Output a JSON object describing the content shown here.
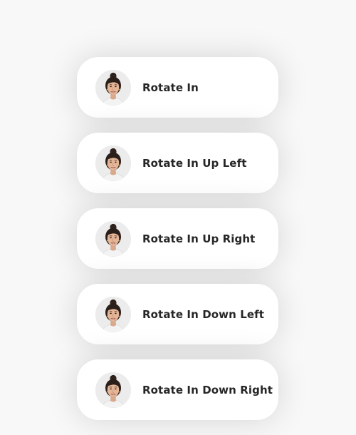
{
  "items": [
    {
      "label": "Rotate In",
      "icon": "woman-avatar-icon"
    },
    {
      "label": "Rotate In Up Left",
      "icon": "woman-avatar-icon"
    },
    {
      "label": "Rotate In Up Right",
      "icon": "woman-avatar-icon"
    },
    {
      "label": "Rotate In Down Left",
      "icon": "woman-avatar-icon"
    },
    {
      "label": "Rotate In Down Right",
      "icon": "woman-avatar-icon"
    }
  ],
  "colors": {
    "background": "#f8f8f8",
    "card": "#ffffff",
    "text": "#262626"
  }
}
